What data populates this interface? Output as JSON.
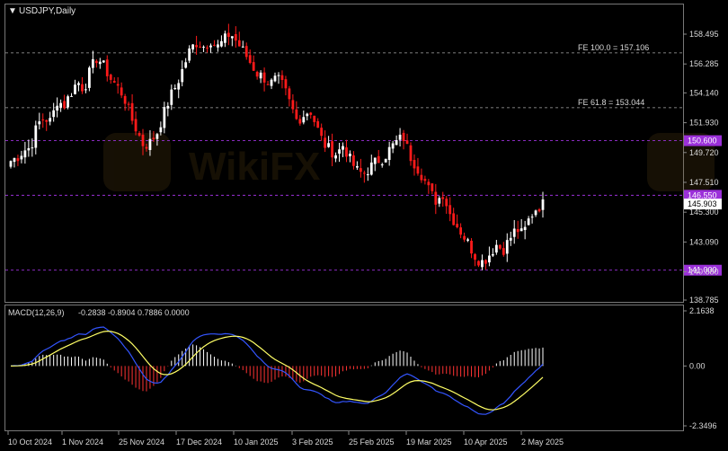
{
  "chart_data": {
    "type": "candlestick",
    "title": "USDJPY,Daily",
    "price_ticks": [
      "158.495",
      "156.285",
      "154.140",
      "151.930",
      "149.720",
      "147.510",
      "145.300",
      "143.090",
      "140.880",
      "138.785"
    ],
    "price_tick_values": [
      158.495,
      156.285,
      154.14,
      151.93,
      149.72,
      147.51,
      145.3,
      143.09,
      140.88,
      138.785
    ],
    "x_labels": [
      "10 Oct 2024",
      "1 Nov 2024",
      "25 Nov 2024",
      "17 Dec 2024",
      "10 Jan 2025",
      "3 Feb 2025",
      "25 Feb 2025",
      "19 Mar 2025",
      "10 Apr 2025",
      "2 May 2025"
    ],
    "levels": [
      {
        "label": "150.600",
        "value": 150.6,
        "color": "#9b30d9"
      },
      {
        "label": "146.550",
        "value": 146.55,
        "color": "#9b30d9"
      },
      {
        "label": "141.000",
        "value": 141.0,
        "color": "#9b30d9"
      }
    ],
    "fe_lines": [
      {
        "label": "FE 100.0 = 157.106",
        "value": 157.106
      },
      {
        "label": "FE 61.8 = 153.044",
        "value": 153.044
      }
    ],
    "current_price": "145.903",
    "ohlc_anchor_close": [
      149.1,
      149.4,
      149.9,
      150.1,
      151.8,
      152.3,
      152.0,
      153.6,
      153.2,
      154.1,
      155.0,
      154.4,
      155.9,
      156.8,
      156.1,
      155.2,
      154.6,
      153.9,
      152.4,
      151.3,
      150.2,
      150.5,
      151.2,
      152.6,
      153.9,
      154.8,
      156.1,
      157.4,
      157.9,
      157.6,
      158.1,
      157.5,
      158.0,
      158.6,
      157.9,
      157.2,
      156.4,
      155.6,
      155.3,
      154.8,
      155.2,
      154.6,
      153.3,
      152.1,
      152.5,
      152.9,
      151.6,
      150.4,
      149.9,
      149.6,
      150.3,
      149.2,
      148.4,
      148.1,
      148.6,
      149.1,
      149.3,
      150.0,
      150.5,
      150.9,
      149.5,
      148.7,
      147.9,
      146.8,
      146.1,
      146.7,
      145.2,
      144.4,
      143.6,
      142.8,
      141.9,
      141.6,
      142.2,
      142.9,
      142.5,
      143.3,
      144.1,
      143.6,
      144.9,
      145.6,
      145.9
    ],
    "macd": {
      "label": "MACD(12,26,9)",
      "values_label": "-0.2838 -0.8904 0.7886 0.0000",
      "ticks": [
        "2.1638",
        "0.00",
        "-2.3496"
      ],
      "tick_values": [
        2.1638,
        0.0,
        -2.3496
      ],
      "histogram_color_pos": "#ffffff",
      "histogram_color_neg": "#ff3333",
      "signal_color": "#ffff66",
      "main_color": "#3355ff"
    },
    "colors": {
      "bull": "#ffffff",
      "bear": "#ff1a1a",
      "grid_dash": "#aaaaaa",
      "axis": "#cfcfcf"
    }
  }
}
